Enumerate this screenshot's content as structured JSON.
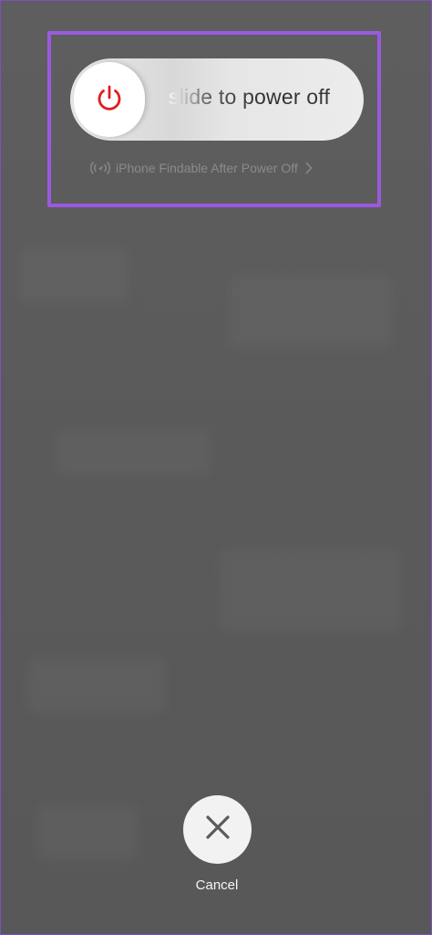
{
  "power_off": {
    "slider_label": "slide to power off",
    "knob_icon": "power-icon",
    "knob_icon_color": "#e11d1d"
  },
  "findable": {
    "icon": "find-my-icon",
    "label": "iPhone Findable After Power Off",
    "chevron": "chevron-right-icon"
  },
  "cancel": {
    "icon": "close-icon",
    "label": "Cancel"
  },
  "colors": {
    "highlight_border": "#9b59e0",
    "background": "#5b5b5b"
  }
}
